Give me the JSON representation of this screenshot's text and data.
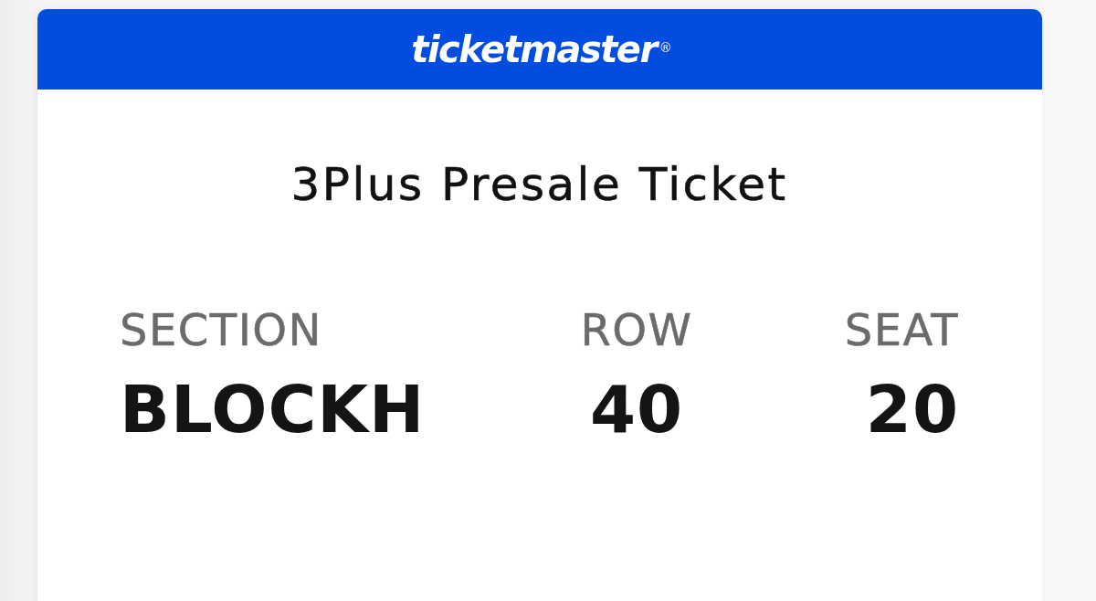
{
  "header": {
    "logo": "ticketmaster",
    "registered_mark": "®"
  },
  "ticket": {
    "title": "3Plus Presale Ticket",
    "fields": [
      {
        "label": "SECTION",
        "value": "BLOCKH"
      },
      {
        "label": "ROW",
        "value": "40"
      },
      {
        "label": "SEAT",
        "value": "20"
      }
    ]
  }
}
